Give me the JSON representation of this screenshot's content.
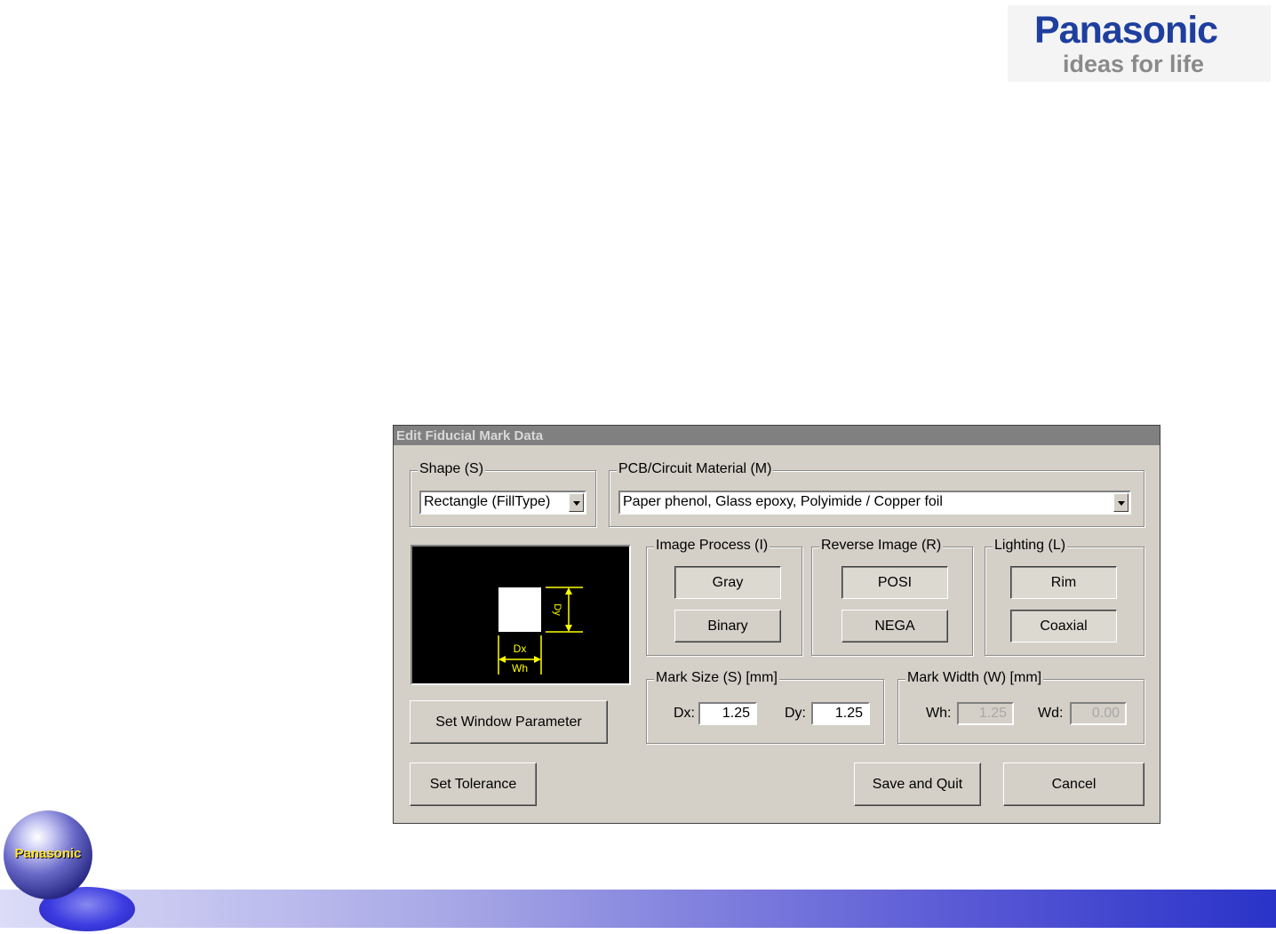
{
  "brand": {
    "name": "Panasonic",
    "slogan": "ideas for life"
  },
  "footer_logo": {
    "label": "Panasonic"
  },
  "dialog": {
    "title": "Edit Fiducial Mark Data",
    "shape": {
      "label": "Shape (S)",
      "value": "Rectangle (FillType)"
    },
    "material": {
      "label": "PCB/Circuit Material (M)",
      "value": "Paper phenol, Glass epoxy, Polyimide / Copper foil"
    },
    "image_process": {
      "label": "Image Process (I)",
      "options": [
        "Gray",
        "Binary"
      ],
      "selected": "Gray"
    },
    "reverse_image": {
      "label": "Reverse Image (R)",
      "options": [
        "POSI",
        "NEGA"
      ],
      "selected": "POSI"
    },
    "lighting": {
      "label": "Lighting (L)",
      "options": [
        "Rim",
        "Coaxial"
      ],
      "selected": "Rim"
    },
    "preview": {
      "dx_label": "Dx",
      "dy_label": "Dy",
      "wh_label": "Wh"
    },
    "mark_size": {
      "label": "Mark Size (S) [mm]",
      "dx_label": "Dx:",
      "dx_value": "1.25",
      "dy_label": "Dy:",
      "dy_value": "1.25"
    },
    "mark_width": {
      "label": "Mark Width (W) [mm]",
      "wh_label": "Wh:",
      "wh_value": "1.25",
      "wd_label": "Wd:",
      "wd_value": "0.00"
    },
    "buttons": {
      "set_window": "Set Window Parameter",
      "set_tolerance": "Set Tolerance",
      "save_quit": "Save and Quit",
      "cancel": "Cancel"
    }
  },
  "colors": {
    "dialog_bg": "#d4d0c8",
    "brand_blue": "#1f3f9f",
    "preview_accent": "#ffff00"
  }
}
